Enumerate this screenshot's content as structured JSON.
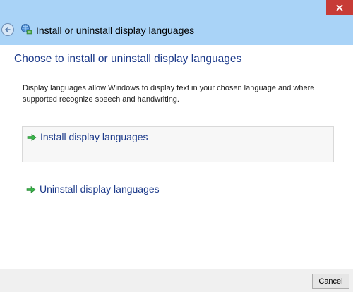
{
  "window": {
    "title": "Install or uninstall display languages",
    "close_icon": "close-icon",
    "back_icon": "back-arrow-icon",
    "app_icon": "language-settings-icon",
    "titlebar_color": "#a9d3f7",
    "close_color": "#c73b36"
  },
  "main": {
    "heading": "Choose to install or uninstall display languages",
    "description": "Display languages allow Windows to display text in your chosen language and where supported recognize speech and handwriting.",
    "options": [
      {
        "label": "Install display languages",
        "icon": "green-arrow-icon"
      },
      {
        "label": "Uninstall display languages",
        "icon": "green-arrow-icon"
      }
    ],
    "link_color": "#1c3a8a"
  },
  "footer": {
    "cancel_label": "Cancel"
  }
}
